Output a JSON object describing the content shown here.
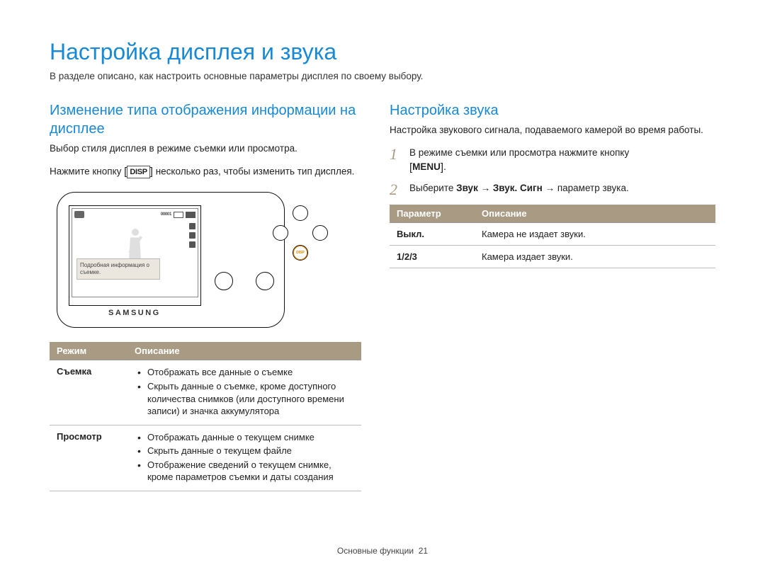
{
  "title": "Настройка дисплея и звука",
  "intro": "В разделе описано, как настроить основные параметры дисплея по своему выбору.",
  "left": {
    "heading": "Изменение типа отображения информации на дисплее",
    "sub": "Выбор стиля дисплея в режиме съемки или просмотра.",
    "instruction_pre": "Нажмите кнопку ",
    "disp_key": "DISP",
    "instruction_post": " несколько раз, чтобы изменить тип дисплея.",
    "camera": {
      "tooltip": "Подробная информация о съемке.",
      "readout": "00001",
      "brand": "SAMSUNG",
      "disp_label": "DISP"
    },
    "table": {
      "headers": [
        "Режим",
        "Описание"
      ],
      "rows": [
        {
          "mode": "Съемка",
          "items": [
            "Отображать все данные о съемке",
            "Скрыть данные о съемке, кроме доступного количества снимков (или доступного времени записи) и значка аккумулятора"
          ]
        },
        {
          "mode": "Просмотр",
          "items": [
            "Отображать данные о текущем снимке",
            "Скрыть данные о текущем файле",
            "Отображение сведений о текущем снимке, кроме параметров съемки и даты создания"
          ]
        }
      ]
    }
  },
  "right": {
    "heading": "Настройка звука",
    "sub": "Настройка звукового сигнала, подаваемого камерой во время работы.",
    "steps": [
      {
        "num": "1",
        "pre": "В режиме съемки или просмотра нажмите кнопку ",
        "key": "MENU",
        "post": "."
      },
      {
        "num": "2",
        "pre": "Выберите ",
        "path": "Звук → Звук. Сигн",
        "post": " → параметр звука."
      }
    ],
    "table": {
      "headers": [
        "Параметр",
        "Описание"
      ],
      "rows": [
        {
          "param": "Выкл.",
          "desc": "Камера не издает звуки."
        },
        {
          "param": "1/2/3",
          "desc": "Камера издает звуки."
        }
      ]
    }
  },
  "footer": {
    "section": "Основные функции",
    "page": "21"
  }
}
